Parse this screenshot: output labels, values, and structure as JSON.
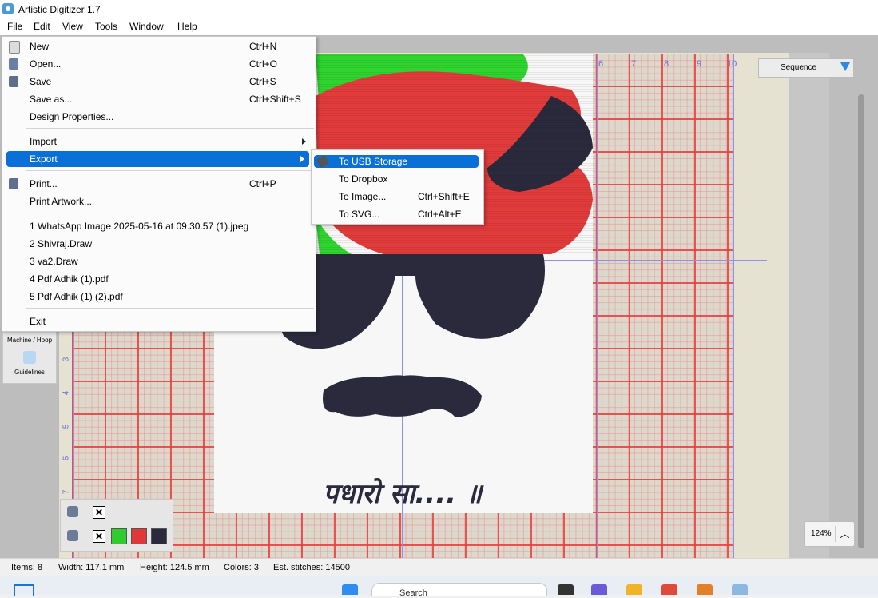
{
  "app": {
    "title": "Artistic Digitizer 1.7"
  },
  "menubar": [
    "File",
    "Edit",
    "View",
    "Tools",
    "Window",
    "Help"
  ],
  "file_menu": {
    "items": [
      {
        "label": "New",
        "shortcut": "Ctrl+N"
      },
      {
        "label": "Open...",
        "shortcut": "Ctrl+O"
      },
      {
        "label": "Save",
        "shortcut": "Ctrl+S"
      },
      {
        "label": "Save as...",
        "shortcut": "Ctrl+Shift+S"
      },
      {
        "label": "Design Properties...",
        "shortcut": ""
      },
      {
        "label": "Import",
        "shortcut": ""
      },
      {
        "label": "Export",
        "shortcut": ""
      },
      {
        "label": "Print...",
        "shortcut": "Ctrl+P"
      },
      {
        "label": "Print Artwork...",
        "shortcut": ""
      },
      {
        "label": "1 WhatsApp Image 2025-05-16 at 09.30.57 (1).jpeg",
        "shortcut": ""
      },
      {
        "label": "2 Shivraj.Draw",
        "shortcut": ""
      },
      {
        "label": "3 va2.Draw",
        "shortcut": ""
      },
      {
        "label": "4 Pdf Adhik (1).pdf",
        "shortcut": ""
      },
      {
        "label": "5 Pdf Adhik (1) (2).pdf",
        "shortcut": ""
      },
      {
        "label": "Exit",
        "shortcut": ""
      }
    ]
  },
  "export_submenu": {
    "items": [
      {
        "label": "To USB Storage",
        "shortcut": ""
      },
      {
        "label": "To Dropbox",
        "shortcut": ""
      },
      {
        "label": "To Image...",
        "shortcut": "Ctrl+Shift+E"
      },
      {
        "label": "To SVG...",
        "shortcut": "Ctrl+Alt+E"
      }
    ]
  },
  "canvas": {
    "caption": "पधारो सा.... ॥",
    "ruler_top": [
      "6",
      "7",
      "8",
      "9",
      "10"
    ],
    "ruler_left": [
      "3",
      "4",
      "5",
      "6",
      "7"
    ]
  },
  "sequence_dropdown": {
    "value": "Sequence"
  },
  "zoom": {
    "value": "124%",
    "up": "︿"
  },
  "sidebar": {
    "machine_hoop": "Machine / Hoop",
    "guidelines": "Guidelines"
  },
  "colors": {
    "green": "#2ecc2e",
    "red": "#e03838",
    "navy": "#2a2a3c",
    "accent": "#0a6fd6"
  },
  "color_panel": {
    "x1": "✕",
    "x2": "✕"
  },
  "status": {
    "items": "Items: 8",
    "width": "Width: 117.1 mm",
    "height": "Height: 124.5 mm",
    "colors": "Colors: 3",
    "stitches": "Est. stitches: 14500"
  },
  "taskbar": {
    "search_placeholder": "Search"
  }
}
